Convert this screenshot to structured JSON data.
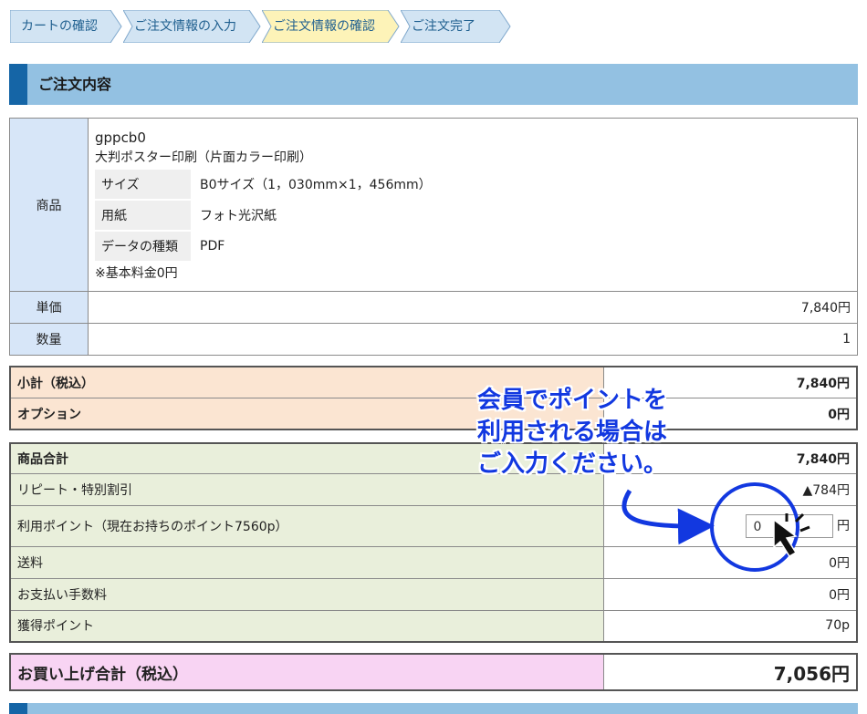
{
  "breadcrumb": {
    "steps": [
      {
        "label": "カートの確認"
      },
      {
        "label": "ご注文情報の入力"
      },
      {
        "label": "ご注文情報の確認"
      },
      {
        "label": "ご注文完了"
      }
    ]
  },
  "section": {
    "title": "ご注文内容"
  },
  "product": {
    "label_product": "商品",
    "code": "gppcb0",
    "name": "大判ポスター印刷（片面カラー印刷）",
    "specs": [
      {
        "key": "サイズ",
        "value": "B0サイズ（1，030mm×1，456mm）"
      },
      {
        "key": "用紙",
        "value": "フォト光沢紙"
      },
      {
        "key": "データの種類",
        "value": "PDF"
      }
    ],
    "note": "※基本料金0円",
    "label_unit_price": "単価",
    "unit_price": "7,840円",
    "label_qty": "数量",
    "qty": "1"
  },
  "subtotal": {
    "label": "小計（税込）",
    "value": "7,840円",
    "option_label": "オプション",
    "option_value": "0円"
  },
  "totals": {
    "product_total_label": "商品合計",
    "product_total": "7,840円",
    "discount_label": "リピート・特別割引",
    "discount": "▲784円",
    "points_label": "利用ポイント（現在お持ちのポイント7560p）",
    "points_input_value": "0",
    "points_unit": "円",
    "shipping_label": "送料",
    "shipping": "0円",
    "fee_label": "お支払い手数料",
    "fee": "0円",
    "earned_label": "獲得ポイント",
    "earned": "70p"
  },
  "grand_total": {
    "label": "お買い上げ合計（税込）",
    "value": "7,056円"
  },
  "callout": {
    "line1": "会員でポイントを",
    "line2": "利用される場合は",
    "line3": "ご入力ください。"
  },
  "colors": {
    "accent": "#1565a6",
    "annotation": "#1238e0"
  }
}
